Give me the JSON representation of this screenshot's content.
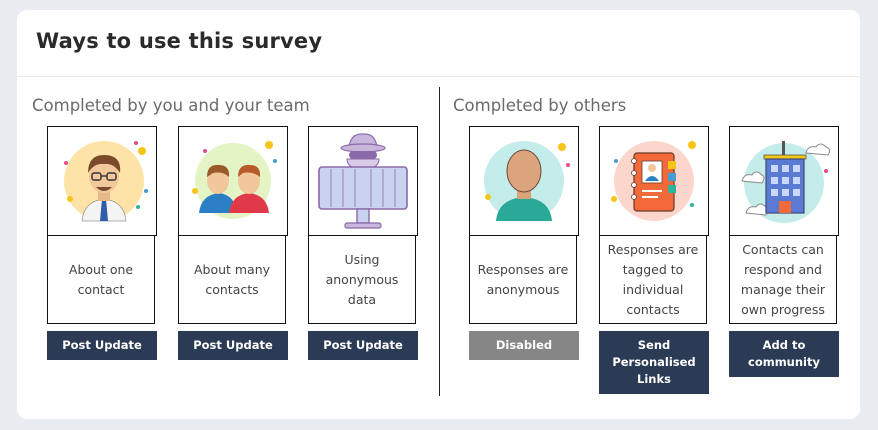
{
  "card": {
    "title": "Ways to use this survey"
  },
  "sections": [
    {
      "title": "Completed by you and your team"
    },
    {
      "title": "Completed by others"
    }
  ],
  "options": [
    {
      "icon": "single-person-icon",
      "description": "About one contact",
      "button_label": "Post Update",
      "button_state": "enabled"
    },
    {
      "icon": "two-people-icon",
      "description": "About many contacts",
      "button_label": "Post Update",
      "button_state": "enabled"
    },
    {
      "icon": "anonymous-spy-icon",
      "description": "Using anonymous data",
      "button_label": "Post Update",
      "button_state": "enabled"
    },
    {
      "icon": "anonymous-person-icon",
      "description": "Responses are anonymous",
      "button_label": "Disabled",
      "button_state": "disabled"
    },
    {
      "icon": "contact-book-icon",
      "description": "Responses are tagged to individual contacts",
      "button_label": "Send Personalised Links",
      "button_state": "enabled"
    },
    {
      "icon": "community-building-icon",
      "description": "Contacts can respond and manage their own progress",
      "button_label": "Add to community",
      "button_state": "enabled"
    }
  ],
  "colors": {
    "button": "#2b3a55",
    "button_disabled": "#868686",
    "background": "#e9edf1"
  }
}
